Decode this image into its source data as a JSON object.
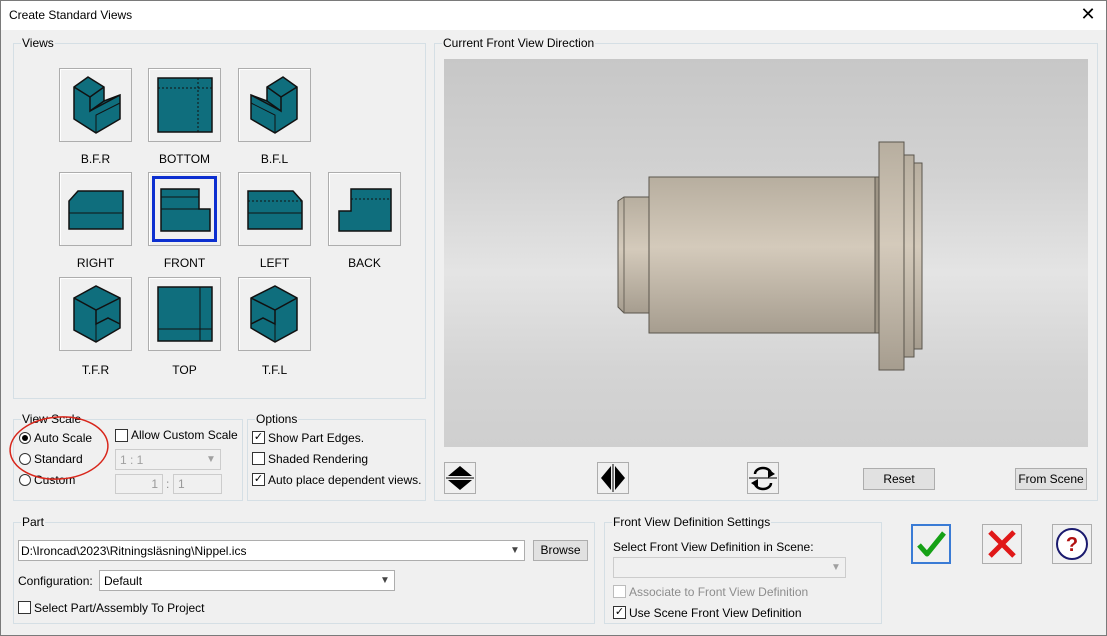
{
  "window": {
    "title": "Create Standard Views",
    "close": "✕"
  },
  "views_group": {
    "legend": "Views",
    "items": [
      {
        "label": "B.F.R",
        "selected": false
      },
      {
        "label": "BOTTOM",
        "selected": false
      },
      {
        "label": "B.F.L",
        "selected": false
      },
      {
        "label": "RIGHT",
        "selected": false
      },
      {
        "label": "FRONT",
        "selected": true
      },
      {
        "label": "LEFT",
        "selected": false
      },
      {
        "label": "BACK",
        "selected": false
      },
      {
        "label": "T.F.R",
        "selected": false
      },
      {
        "label": "TOP",
        "selected": false
      },
      {
        "label": "T.F.L",
        "selected": false
      }
    ]
  },
  "preview": {
    "legend": "Current Front View Direction"
  },
  "view_scale": {
    "legend": "View Scale",
    "options": [
      {
        "label": "Auto Scale",
        "checked": true
      },
      {
        "label": "Standard",
        "checked": false
      },
      {
        "label": "Custom",
        "checked": false
      }
    ],
    "allow_custom_label": "Allow Custom Scale",
    "scale_value": "1 : 1",
    "custom_left": "1",
    "custom_sep": ":",
    "custom_right": "1"
  },
  "options": {
    "legend": "Options",
    "show_part_edges": "Show Part Edges.",
    "shaded_rendering": "Shaded Rendering",
    "auto_place": "Auto place dependent views."
  },
  "controls": {
    "reset": "Reset",
    "from_scene": "From Scene"
  },
  "part": {
    "legend": "Part",
    "path": "D:\\Ironcad\\2023\\Ritningsläsning\\Nippel.ics",
    "browse": "Browse",
    "configuration_label": "Configuration:",
    "configuration_value": "Default",
    "select_part_label": "Select Part/Assembly To Project"
  },
  "front_def": {
    "legend": "Front View Definition Settings",
    "select_label": "Select Front View Definition in Scene:",
    "associate_label": "Associate to Front View Definition",
    "use_scene_label": "Use Scene Front View Definition"
  },
  "colors": {
    "accent": "#0c2fd0",
    "teal": "#0f6e7d",
    "ok": "#16a116",
    "cancel": "#e01818",
    "help": "#1a1a6e"
  }
}
